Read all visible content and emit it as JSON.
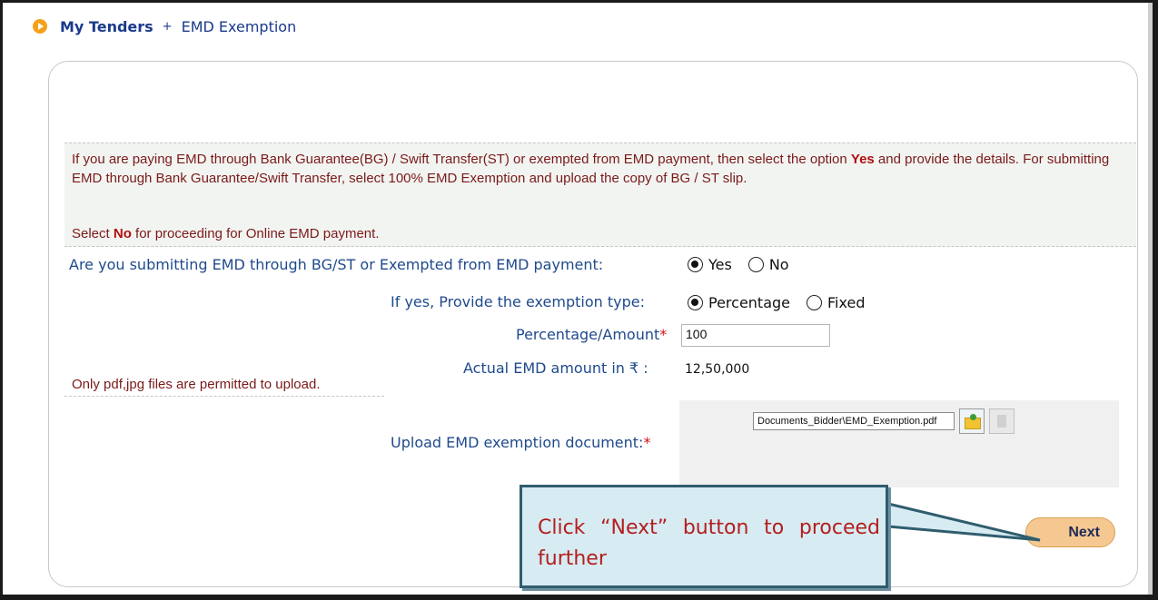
{
  "breadcrumb": {
    "main": "My Tenders",
    "separator": "+",
    "current": "EMD Exemption"
  },
  "notice": {
    "line1_a": "If you are paying EMD through Bank Guarantee(BG) / Swift Transfer(ST) or exempted from EMD payment, then select the option ",
    "line1_b": "Yes",
    "line1_c": " and provide the details. For submitting EMD through Bank Guarantee/Swift Transfer, select 100% EMD Exemption and upload the copy of BG / ST slip.",
    "line2_a": "Select ",
    "line2_b": "No",
    "line2_c": " for proceeding for Online EMD payment."
  },
  "form": {
    "q1_label": "Are you submitting EMD through BG/ST or Exempted from EMD payment:",
    "q1_yes": "Yes",
    "q1_no": "No",
    "q2_label": "If yes, Provide the exemption type:",
    "q2_percentage": "Percentage",
    "q2_fixed": "Fixed",
    "amount_label": "Percentage/Amount",
    "amount_required": "*",
    "amount_value": "100",
    "actual_label": "Actual EMD amount in ₹ :",
    "actual_value": "12,50,000",
    "file_note": "Only pdf,jpg files are permitted to upload.",
    "upload_label": "Upload EMD exemption document:",
    "upload_required": "*",
    "upload_file": "Documents_Bidder\\EMD_Exemption.pdf"
  },
  "next_label": "Next",
  "callout_text": "Click “Next” button to proceed further",
  "icons": {
    "breadcrumb": "arrow-circle-icon",
    "browse": "folder-icon",
    "clear": "clear-icon"
  },
  "colors": {
    "accent": "#f5a01a",
    "link": "#1a3a8c",
    "notice_text": "#7a1a1a",
    "callout_bg": "#d7ebf2",
    "callout_border": "#2f5d6e"
  }
}
